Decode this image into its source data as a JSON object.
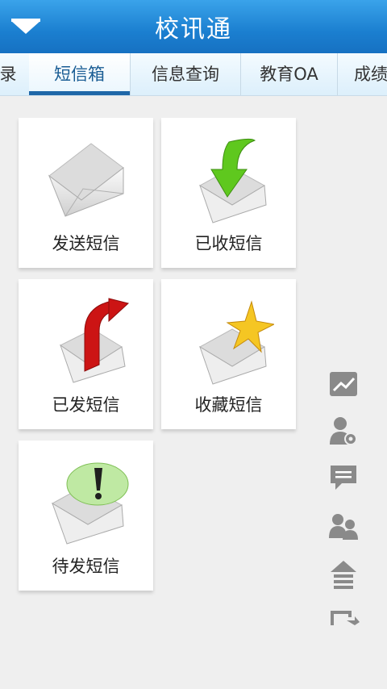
{
  "header": {
    "title": "校讯通",
    "menu_icon": "menu-arrow-icon"
  },
  "tabs": [
    {
      "label": "录"
    },
    {
      "label": "短信箱"
    },
    {
      "label": "信息查询"
    },
    {
      "label": "教育OA"
    },
    {
      "label": "成绩"
    }
  ],
  "cards": [
    {
      "label": "发送短信",
      "icon": "envelope-send-icon"
    },
    {
      "label": "已收短信",
      "icon": "envelope-inbox-icon"
    },
    {
      "label": "已发短信",
      "icon": "envelope-sent-icon"
    },
    {
      "label": "收藏短信",
      "icon": "envelope-favorite-icon"
    },
    {
      "label": "待发短信",
      "icon": "envelope-pending-icon"
    }
  ],
  "sidebar": [
    "chart-icon",
    "user-settings-icon",
    "chat-bubble-icon",
    "users-icon",
    "upload-icon",
    "exit-icon"
  ],
  "colors": {
    "header": "#1b7fd0",
    "active_tab": "#1f67a8",
    "icon_gray": "#8a8a8a"
  }
}
